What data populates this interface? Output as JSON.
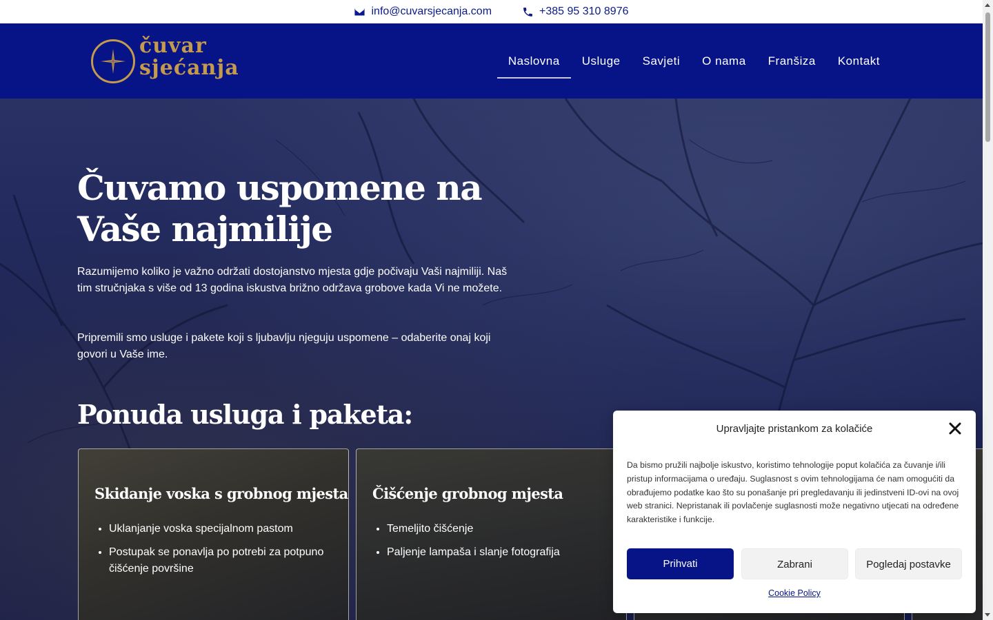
{
  "topbar": {
    "email": "info@cuvarsjecanja.com",
    "phone": "+385 95 310 8976"
  },
  "logo": {
    "line1": "čuvar",
    "line2": "sjećanja"
  },
  "nav": {
    "items": [
      {
        "label": "Naslovna",
        "active": true
      },
      {
        "label": "Usluge"
      },
      {
        "label": "Savjeti"
      },
      {
        "label": "O nama"
      },
      {
        "label": "Franšiza"
      },
      {
        "label": "Kontakt"
      }
    ]
  },
  "hero": {
    "title": "Čuvamo uspomene na Vaše najmilije",
    "paragraph1": "Razumijemo koliko je važno održati dostojanstvo mjesta gdje počivaju Vaši najmiliji. Naš tim stručnjaka s više od 13 godina iskustva brižno održava grobove kada Vi ne možete.",
    "paragraph2": "Pripremili smo usluge i pakete koji s ljubavlju njeguju uspomene – odaberite onaj koji govori u Vaše ime.",
    "section_title": "Ponuda usluga i paketa:"
  },
  "cards": [
    {
      "title": "Skidanje voska s grobnog mjesta",
      "items": [
        "Uklanjanje voska specijalnom pastom",
        "Postupak se ponavlja po potrebi za potpuno čišćenje površine"
      ]
    },
    {
      "title": "Čišćenje grobnog mjesta",
      "items": [
        "Temeljito čišćenje",
        "Paljenje lampaša i slanje fotografija"
      ]
    },
    {
      "title": "",
      "items": []
    }
  ],
  "cookie": {
    "title": "Upravljajte pristankom za kolačiće",
    "body": "Da bismo pružili najbolje iskustvo, koristimo tehnologije poput kolačića za čuvanje i/ili pristup informacijama o uređaju. Suglasnost s ovim tehnologijama će nam omogućiti da obrađujemo podatke kao što su ponašanje pri pregledavanju ili jedinstveni ID-ovi na ovoj web stranici. Nepristanak ili povlačenje suglasnosti može negativno utjecati na određene karakteristike i funkcije.",
    "accept": "Prihvati",
    "deny": "Zabrani",
    "preferences": "Pogledaj postavke",
    "policy_link": "Cookie Policy"
  },
  "colors": {
    "brand_blue": "#061487",
    "gold": "#c49a4c"
  }
}
